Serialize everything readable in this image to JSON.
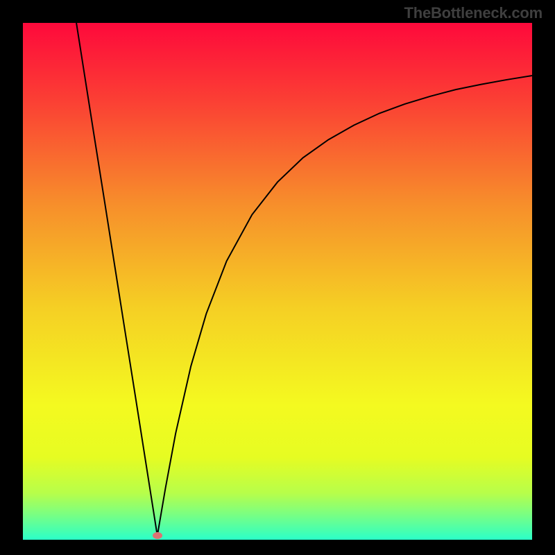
{
  "watermark": "TheBottleneck.com",
  "chart_data": {
    "type": "line",
    "title": "",
    "xlabel": "",
    "ylabel": "",
    "xlim": [
      0,
      100
    ],
    "ylim": [
      0,
      100
    ],
    "grid": false,
    "axes_visible": false,
    "background": "vertical-gradient red→orange→yellow→green",
    "gradient_stops": [
      {
        "pos": 0.0,
        "color": "#fe093b"
      },
      {
        "pos": 0.15,
        "color": "#fb3f34"
      },
      {
        "pos": 0.35,
        "color": "#f78e2b"
      },
      {
        "pos": 0.55,
        "color": "#f5cf24"
      },
      {
        "pos": 0.74,
        "color": "#f4fa20"
      },
      {
        "pos": 0.84,
        "color": "#e6fc22"
      },
      {
        "pos": 0.91,
        "color": "#b7fe4a"
      },
      {
        "pos": 0.95,
        "color": "#7bff81"
      },
      {
        "pos": 1.0,
        "color": "#2bffc8"
      }
    ],
    "series": [
      {
        "name": "left-branch",
        "x": [
          10.5,
          12,
          14,
          16,
          18,
          20,
          22,
          24,
          26.4
        ],
        "y": [
          100,
          90.6,
          78.1,
          65.7,
          53.2,
          40.7,
          28.3,
          15.8,
          0.8
        ]
      },
      {
        "name": "right-branch",
        "x": [
          26.4,
          28,
          30,
          33,
          36,
          40,
          45,
          50,
          55,
          60,
          65,
          70,
          75,
          80,
          85,
          90,
          95,
          100
        ],
        "y": [
          0.8,
          10.0,
          20.6,
          33.6,
          43.7,
          53.9,
          62.9,
          69.2,
          73.9,
          77.4,
          80.2,
          82.5,
          84.3,
          85.8,
          87.1,
          88.1,
          89.0,
          89.8
        ]
      }
    ],
    "marker": {
      "x": 26.4,
      "y": 0.8,
      "color": "#dc7373"
    }
  }
}
